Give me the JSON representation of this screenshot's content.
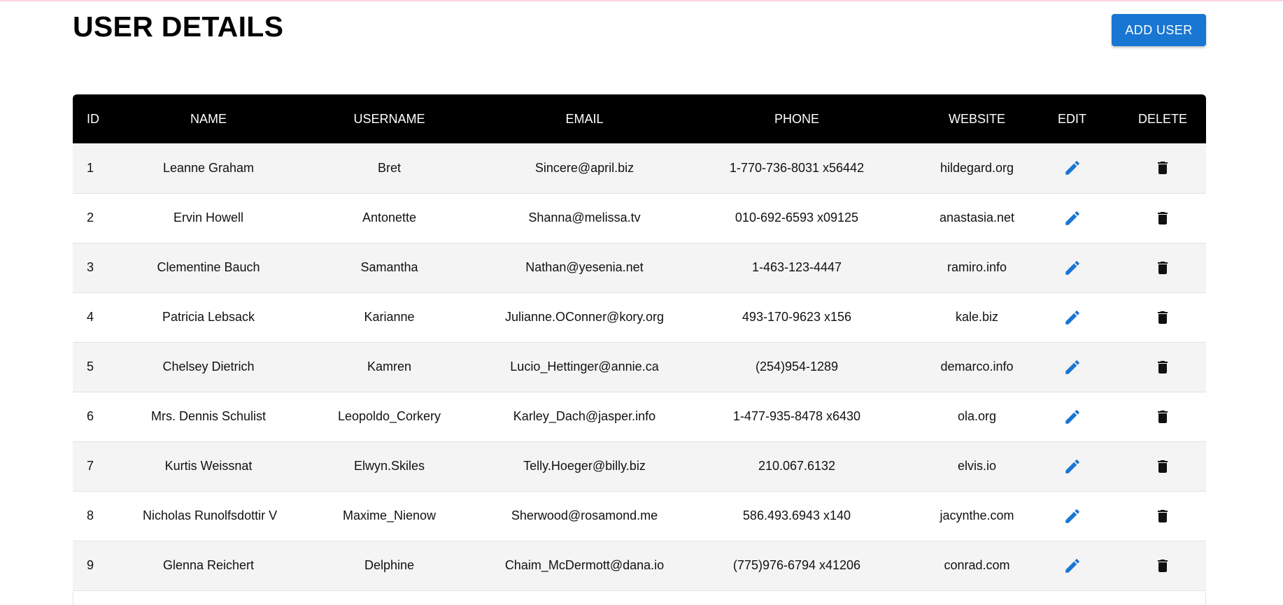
{
  "header": {
    "title": "USER DETAILS",
    "add_user_label": "ADD USER"
  },
  "table": {
    "columns": [
      "ID",
      "NAME",
      "USERNAME",
      "EMAIL",
      "PHONE",
      "WEBSITE",
      "EDIT",
      "DELETE"
    ],
    "rows": [
      {
        "id": "1",
        "name": "Leanne Graham",
        "username": "Bret",
        "email": "Sincere@april.biz",
        "phone": "1-770-736-8031 x56442",
        "website": "hildegard.org"
      },
      {
        "id": "2",
        "name": "Ervin Howell",
        "username": "Antonette",
        "email": "Shanna@melissa.tv",
        "phone": "010-692-6593 x09125",
        "website": "anastasia.net"
      },
      {
        "id": "3",
        "name": "Clementine Bauch",
        "username": "Samantha",
        "email": "Nathan@yesenia.net",
        "phone": "1-463-123-4447",
        "website": "ramiro.info"
      },
      {
        "id": "4",
        "name": "Patricia Lebsack",
        "username": "Karianne",
        "email": "Julianne.OConner@kory.org",
        "phone": "493-170-9623 x156",
        "website": "kale.biz"
      },
      {
        "id": "5",
        "name": "Chelsey Dietrich",
        "username": "Kamren",
        "email": "Lucio_Hettinger@annie.ca",
        "phone": "(254)954-1289",
        "website": "demarco.info"
      },
      {
        "id": "6",
        "name": "Mrs. Dennis Schulist",
        "username": "Leopoldo_Corkery",
        "email": "Karley_Dach@jasper.info",
        "phone": "1-477-935-8478 x6430",
        "website": "ola.org"
      },
      {
        "id": "7",
        "name": "Kurtis Weissnat",
        "username": "Elwyn.Skiles",
        "email": "Telly.Hoeger@billy.biz",
        "phone": "210.067.6132",
        "website": "elvis.io"
      },
      {
        "id": "8",
        "name": "Nicholas Runolfsdottir V",
        "username": "Maxime_Nienow",
        "email": "Sherwood@rosamond.me",
        "phone": "586.493.6943 x140",
        "website": "jacynthe.com"
      },
      {
        "id": "9",
        "name": "Glenna Reichert",
        "username": "Delphine",
        "email": "Chaim_McDermott@dana.io",
        "phone": "(775)976-6794 x41206",
        "website": "conrad.com"
      }
    ]
  },
  "icons": {
    "edit": "pencil-icon",
    "delete": "trash-icon"
  },
  "colors": {
    "primary": "#1976d2",
    "header_bg": "#000000",
    "edit_icon": "#1976d2",
    "delete_icon": "#111111",
    "row_alt": "#f4f4f4"
  }
}
